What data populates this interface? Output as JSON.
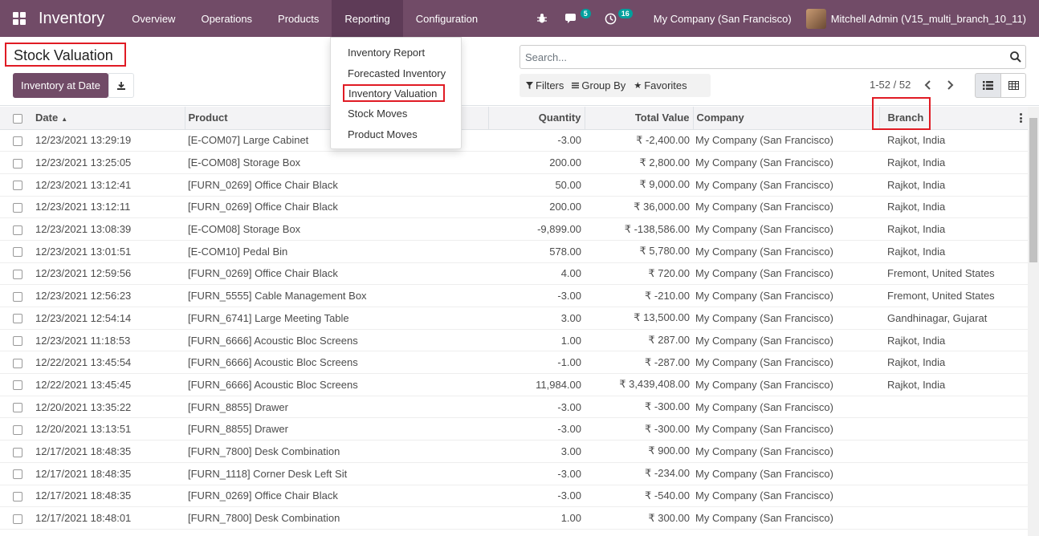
{
  "app": {
    "name": "Inventory"
  },
  "nav": {
    "menus": [
      {
        "label": "Overview"
      },
      {
        "label": "Operations"
      },
      {
        "label": "Products"
      },
      {
        "label": "Reporting"
      },
      {
        "label": "Configuration"
      }
    ],
    "messages_badge": "5",
    "activities_badge": "16",
    "company": "My Company (San Francisco)",
    "user": "Mitchell Admin (V15_multi_branch_10_11)"
  },
  "reporting_menu": {
    "items": [
      {
        "label": "Inventory Report"
      },
      {
        "label": "Forecasted Inventory"
      },
      {
        "label": "Inventory Valuation"
      },
      {
        "label": "Stock Moves"
      },
      {
        "label": "Product Moves"
      }
    ]
  },
  "page": {
    "title": "Stock Valuation"
  },
  "actions": {
    "inventory_at_date": "Inventory at Date"
  },
  "search": {
    "placeholder": "Search..."
  },
  "filters": {
    "filters_label": "Filters",
    "groupby_label": "Group By",
    "favorites_label": "Favorites"
  },
  "pager": {
    "value": "1-52 / 52"
  },
  "table": {
    "headers": {
      "date": "Date",
      "product": "Product",
      "quantity": "Quantity",
      "total_value": "Total Value",
      "company": "Company",
      "branch": "Branch"
    },
    "rows": [
      {
        "date": "12/23/2021 13:29:19",
        "product": "[E-COM07] Large Cabinet",
        "quantity": "-3.00",
        "value": "₹ -2,400.00",
        "company": "My Company (San Francisco)",
        "branch": "Rajkot, India"
      },
      {
        "date": "12/23/2021 13:25:05",
        "product": "[E-COM08] Storage Box",
        "quantity": "200.00",
        "value": "₹ 2,800.00",
        "company": "My Company (San Francisco)",
        "branch": "Rajkot, India"
      },
      {
        "date": "12/23/2021 13:12:41",
        "product": "[FURN_0269] Office Chair Black",
        "quantity": "50.00",
        "value": "₹ 9,000.00",
        "company": "My Company (San Francisco)",
        "branch": "Rajkot, India"
      },
      {
        "date": "12/23/2021 13:12:11",
        "product": "[FURN_0269] Office Chair Black",
        "quantity": "200.00",
        "value": "₹ 36,000.00",
        "company": "My Company (San Francisco)",
        "branch": "Rajkot, India"
      },
      {
        "date": "12/23/2021 13:08:39",
        "product": "[E-COM08] Storage Box",
        "quantity": "-9,899.00",
        "value": "₹ -138,586.00",
        "company": "My Company (San Francisco)",
        "branch": "Rajkot, India"
      },
      {
        "date": "12/23/2021 13:01:51",
        "product": "[E-COM10] Pedal Bin",
        "quantity": "578.00",
        "value": "₹ 5,780.00",
        "company": "My Company (San Francisco)",
        "branch": "Rajkot, India"
      },
      {
        "date": "12/23/2021 12:59:56",
        "product": "[FURN_0269] Office Chair Black",
        "quantity": "4.00",
        "value": "₹ 720.00",
        "company": "My Company (San Francisco)",
        "branch": "Fremont, United States"
      },
      {
        "date": "12/23/2021 12:56:23",
        "product": "[FURN_5555] Cable Management Box",
        "quantity": "-3.00",
        "value": "₹ -210.00",
        "company": "My Company (San Francisco)",
        "branch": "Fremont, United States"
      },
      {
        "date": "12/23/2021 12:54:14",
        "product": "[FURN_6741] Large Meeting Table",
        "quantity": "3.00",
        "value": "₹ 13,500.00",
        "company": "My Company (San Francisco)",
        "branch": "Gandhinagar, Gujarat"
      },
      {
        "date": "12/23/2021 11:18:53",
        "product": "[FURN_6666] Acoustic Bloc Screens",
        "quantity": "1.00",
        "value": "₹ 287.00",
        "company": "My Company (San Francisco)",
        "branch": "Rajkot, India"
      },
      {
        "date": "12/22/2021 13:45:54",
        "product": "[FURN_6666] Acoustic Bloc Screens",
        "quantity": "-1.00",
        "value": "₹ -287.00",
        "company": "My Company (San Francisco)",
        "branch": "Rajkot, India"
      },
      {
        "date": "12/22/2021 13:45:45",
        "product": "[FURN_6666] Acoustic Bloc Screens",
        "quantity": "11,984.00",
        "value": "₹ 3,439,408.00",
        "company": "My Company (San Francisco)",
        "branch": "Rajkot, India"
      },
      {
        "date": "12/20/2021 13:35:22",
        "product": "[FURN_8855] Drawer",
        "quantity": "-3.00",
        "value": "₹ -300.00",
        "company": "My Company (San Francisco)",
        "branch": ""
      },
      {
        "date": "12/20/2021 13:13:51",
        "product": "[FURN_8855] Drawer",
        "quantity": "-3.00",
        "value": "₹ -300.00",
        "company": "My Company (San Francisco)",
        "branch": ""
      },
      {
        "date": "12/17/2021 18:48:35",
        "product": "[FURN_7800] Desk Combination",
        "quantity": "3.00",
        "value": "₹ 900.00",
        "company": "My Company (San Francisco)",
        "branch": ""
      },
      {
        "date": "12/17/2021 18:48:35",
        "product": "[FURN_1118] Corner Desk Left Sit",
        "quantity": "-3.00",
        "value": "₹ -234.00",
        "company": "My Company (San Francisco)",
        "branch": ""
      },
      {
        "date": "12/17/2021 18:48:35",
        "product": "[FURN_0269] Office Chair Black",
        "quantity": "-3.00",
        "value": "₹ -540.00",
        "company": "My Company (San Francisco)",
        "branch": ""
      },
      {
        "date": "12/17/2021 18:48:01",
        "product": "[FURN_7800] Desk Combination",
        "quantity": "1.00",
        "value": "₹ 300.00",
        "company": "My Company (San Francisco)",
        "branch": ""
      }
    ]
  },
  "colors": {
    "brand": "#714b67",
    "highlight": "#e01b24",
    "badge": "#00a09d"
  }
}
